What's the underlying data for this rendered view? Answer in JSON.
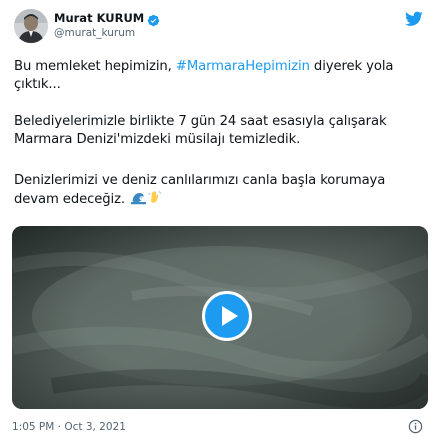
{
  "author": {
    "display_name": "Murat KURUM",
    "handle": "@murat_kurum",
    "verified": true
  },
  "tweet": {
    "line1_before": "Bu memleket hepimizin, ",
    "hashtag": "#MarmaraHepimizin",
    "line1_after": "  diyerek yola çıktık...",
    "paragraph2": "Belediyelerimizle birlikte 7 gün 24 saat esasıyla çalışarak Marmara Denizi'mizdeki müsilajı temizledik.",
    "paragraph3": "Denizlerimizi ve deniz canlılarımızı canla başla korumaya devam edeceğiz.",
    "emojis": [
      "wave-emoji",
      "waving-hand-emoji"
    ]
  },
  "media": {
    "type": "video",
    "play_icon": "play-icon"
  },
  "footer": {
    "timestamp": "1:05 PM · Oct 3, 2021"
  },
  "colors": {
    "accent": "#1d9bf0",
    "text": "#0f1419",
    "muted": "#536471"
  }
}
